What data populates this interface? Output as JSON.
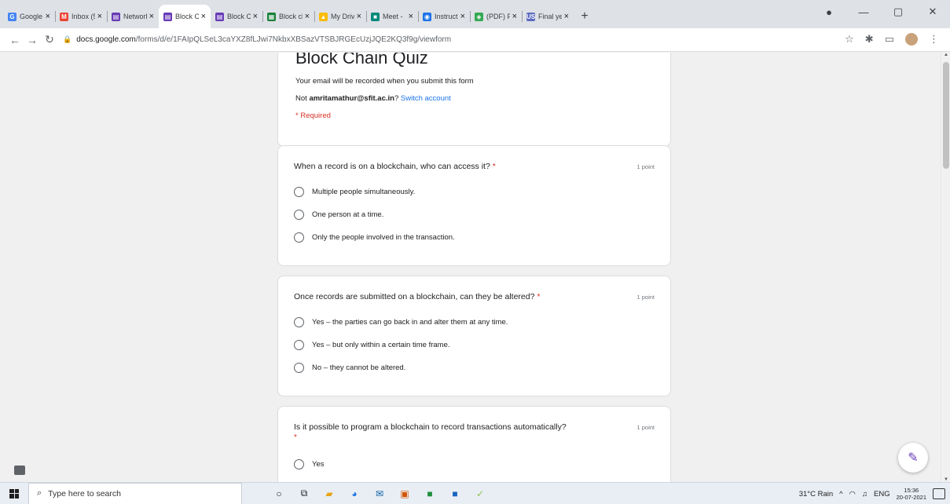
{
  "browser": {
    "tabs": [
      {
        "label": "Google",
        "favicon": "G",
        "color": "#4285f4",
        "active": false
      },
      {
        "label": "Inbox (5",
        "favicon": "M",
        "color": "#ea4335",
        "active": false
      },
      {
        "label": "Network",
        "favicon": "▤",
        "color": "#673ab7",
        "active": false
      },
      {
        "label": "Block Ch",
        "favicon": "▤",
        "color": "#673ab7",
        "active": true
      },
      {
        "label": "Block Ch",
        "favicon": "▤",
        "color": "#673ab7",
        "active": false
      },
      {
        "label": "Block ch",
        "favicon": "▦",
        "color": "#188038",
        "active": false
      },
      {
        "label": "My Drive",
        "favicon": "▲",
        "color": "#fbbc04",
        "active": false
      },
      {
        "label": "Meet -",
        "favicon": "■",
        "color": "#00897b",
        "active": false
      },
      {
        "label": "Instructi",
        "favicon": "◉",
        "color": "#1a73e8",
        "active": false
      },
      {
        "label": "(PDF) Fi",
        "favicon": "◈",
        "color": "#34a853",
        "active": false
      },
      {
        "label": "Final yea",
        "favicon": "US",
        "color": "#5c6bc0",
        "active": false
      }
    ],
    "new_tab": "+",
    "url_host": "docs.google.com",
    "url_path": "/forms/d/e/1FAIpQLSeL3caYXZ8fLJwi7NkbxXBSazVTSBJRGEcUzjJQE2KQ3f9g/viewform"
  },
  "form": {
    "title": "Block Chain Quiz",
    "email_note": "Your email will be recorded when you submit this form",
    "not_prefix": "Not ",
    "account": "amritamathur@sfit.ac.in",
    "question_mark": "?",
    "switch_link": "Switch account",
    "required": "* Required",
    "questions": [
      {
        "text": "When a record is on a blockchain, who can access it?",
        "required_mark": "*",
        "points": "1 point",
        "options": [
          "Multiple people simultaneously.",
          "One person at a time.",
          "Only the people involved in the transaction."
        ]
      },
      {
        "text": "Once records are submitted on a blockchain, can they be altered?",
        "required_mark": "*",
        "points": "1 point",
        "options": [
          "Yes – the parties can go back in and alter them at any time.",
          "Yes – but only within a certain time frame.",
          "No – they cannot be altered."
        ]
      },
      {
        "text": "Is it possible to program a blockchain to record transactions automatically?",
        "required_mark": "*",
        "points": "1 point",
        "options": [
          "Yes"
        ]
      }
    ]
  },
  "taskbar": {
    "search_placeholder": "Type here to search",
    "weather": "31°C Rain",
    "lang": "ENG",
    "time": "15:36",
    "date": "20-07-2021"
  }
}
